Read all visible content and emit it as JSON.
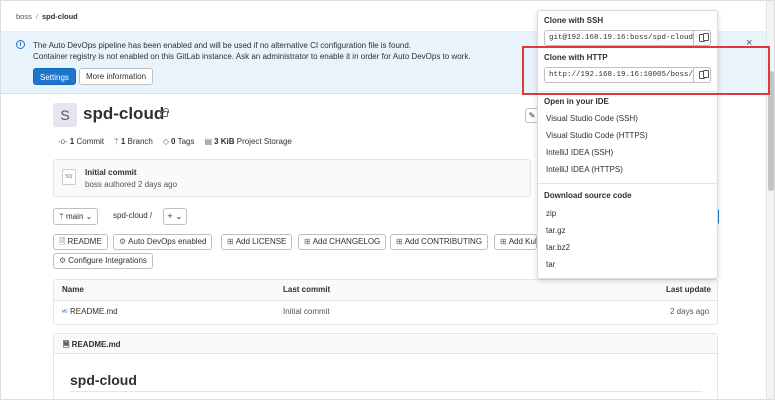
{
  "breadcrumb": {
    "group": "boss",
    "separator": "/",
    "project": "spd-cloud"
  },
  "banner": {
    "line1": "The Auto DevOps pipeline has been enabled and will be used if no alternative CI configuration file is found.",
    "line2": "Container registry is not enabled on this GitLab instance. Ask an administrator to enable it in order for Auto DevOps to work.",
    "settings_label": "Settings",
    "more_info_label": "More information",
    "info_glyph": "i",
    "close_glyph": "×"
  },
  "project": {
    "avatar_letter": "S",
    "name": "spd-cloud",
    "edit_glyph": "✎",
    "stats": [
      {
        "icon": "commit-icon",
        "glyph": "-o-",
        "count": "1",
        "label": "Commit"
      },
      {
        "icon": "branch-icon",
        "glyph": "ᛘ",
        "count": "1",
        "label": "Branch"
      },
      {
        "icon": "tag-icon",
        "glyph": "◇",
        "count": "0",
        "label": "Tags"
      },
      {
        "icon": "storage-icon",
        "glyph": "▤",
        "count": "3 KiB",
        "label": "Project Storage"
      }
    ]
  },
  "commit": {
    "avatar_alt": "50(",
    "title": "Initial commit",
    "meta": "boss authored 2 days ago"
  },
  "branch_row": {
    "branch": "main",
    "path": "spd-cloud",
    "path_sep": "/",
    "plus_label": "+ ⌄",
    "branch_glyph": "ᛘ",
    "chevron": "⌄"
  },
  "actions": [
    {
      "icon": "file-icon",
      "glyph": "🗎",
      "label": "README"
    },
    {
      "icon": "gear-icon",
      "glyph": "⚙",
      "label": "Auto DevOps enabled"
    },
    {
      "icon": "plus-icon",
      "glyph": "⊞",
      "label": "Add LICENSE"
    },
    {
      "icon": "plus-icon",
      "glyph": "⊞",
      "label": "Add CHANGELOG"
    },
    {
      "icon": "plus-icon",
      "glyph": "⊞",
      "label": "Add CONTRIBUTING"
    },
    {
      "icon": "plus-icon",
      "glyph": "⊞",
      "label": "Add Kubernetes cluster"
    },
    {
      "icon": "gear-icon",
      "glyph": "⚙",
      "label": "Configure Integrations"
    }
  ],
  "file_table": {
    "headers": {
      "name": "Name",
      "last_commit": "Last commit",
      "last_update": "Last update"
    },
    "rows": [
      {
        "glyph": "ᴹᴰ",
        "name": "README.md",
        "last_commit": "Initial commit",
        "last_update": "2 days ago"
      }
    ]
  },
  "readme": {
    "file_glyph": "🗎",
    "filename": "README.md",
    "heading": "spd-cloud"
  },
  "clone_dropdown": {
    "ssh_label": "Clone with SSH",
    "ssh_url": "git@192.168.19.16:boss/spd-cloud.git",
    "http_label": "Clone with HTTP",
    "http_url": "http://192.168.19.16:10005/boss/spd-cloud.git",
    "ide_label": "Open in your IDE",
    "ide_items": [
      "Visual Studio Code (SSH)",
      "Visual Studio Code (HTTPS)",
      "IntelliJ IDEA (SSH)",
      "IntelliJ IDEA (HTTPS)"
    ],
    "download_label": "Download source code",
    "download_items": [
      "zip",
      "tar.gz",
      "tar.bz2",
      "tar"
    ]
  },
  "colors": {
    "primary": "#1f75cb",
    "banner_bg": "#e9f3fc",
    "highlight": "#d93b3b"
  }
}
